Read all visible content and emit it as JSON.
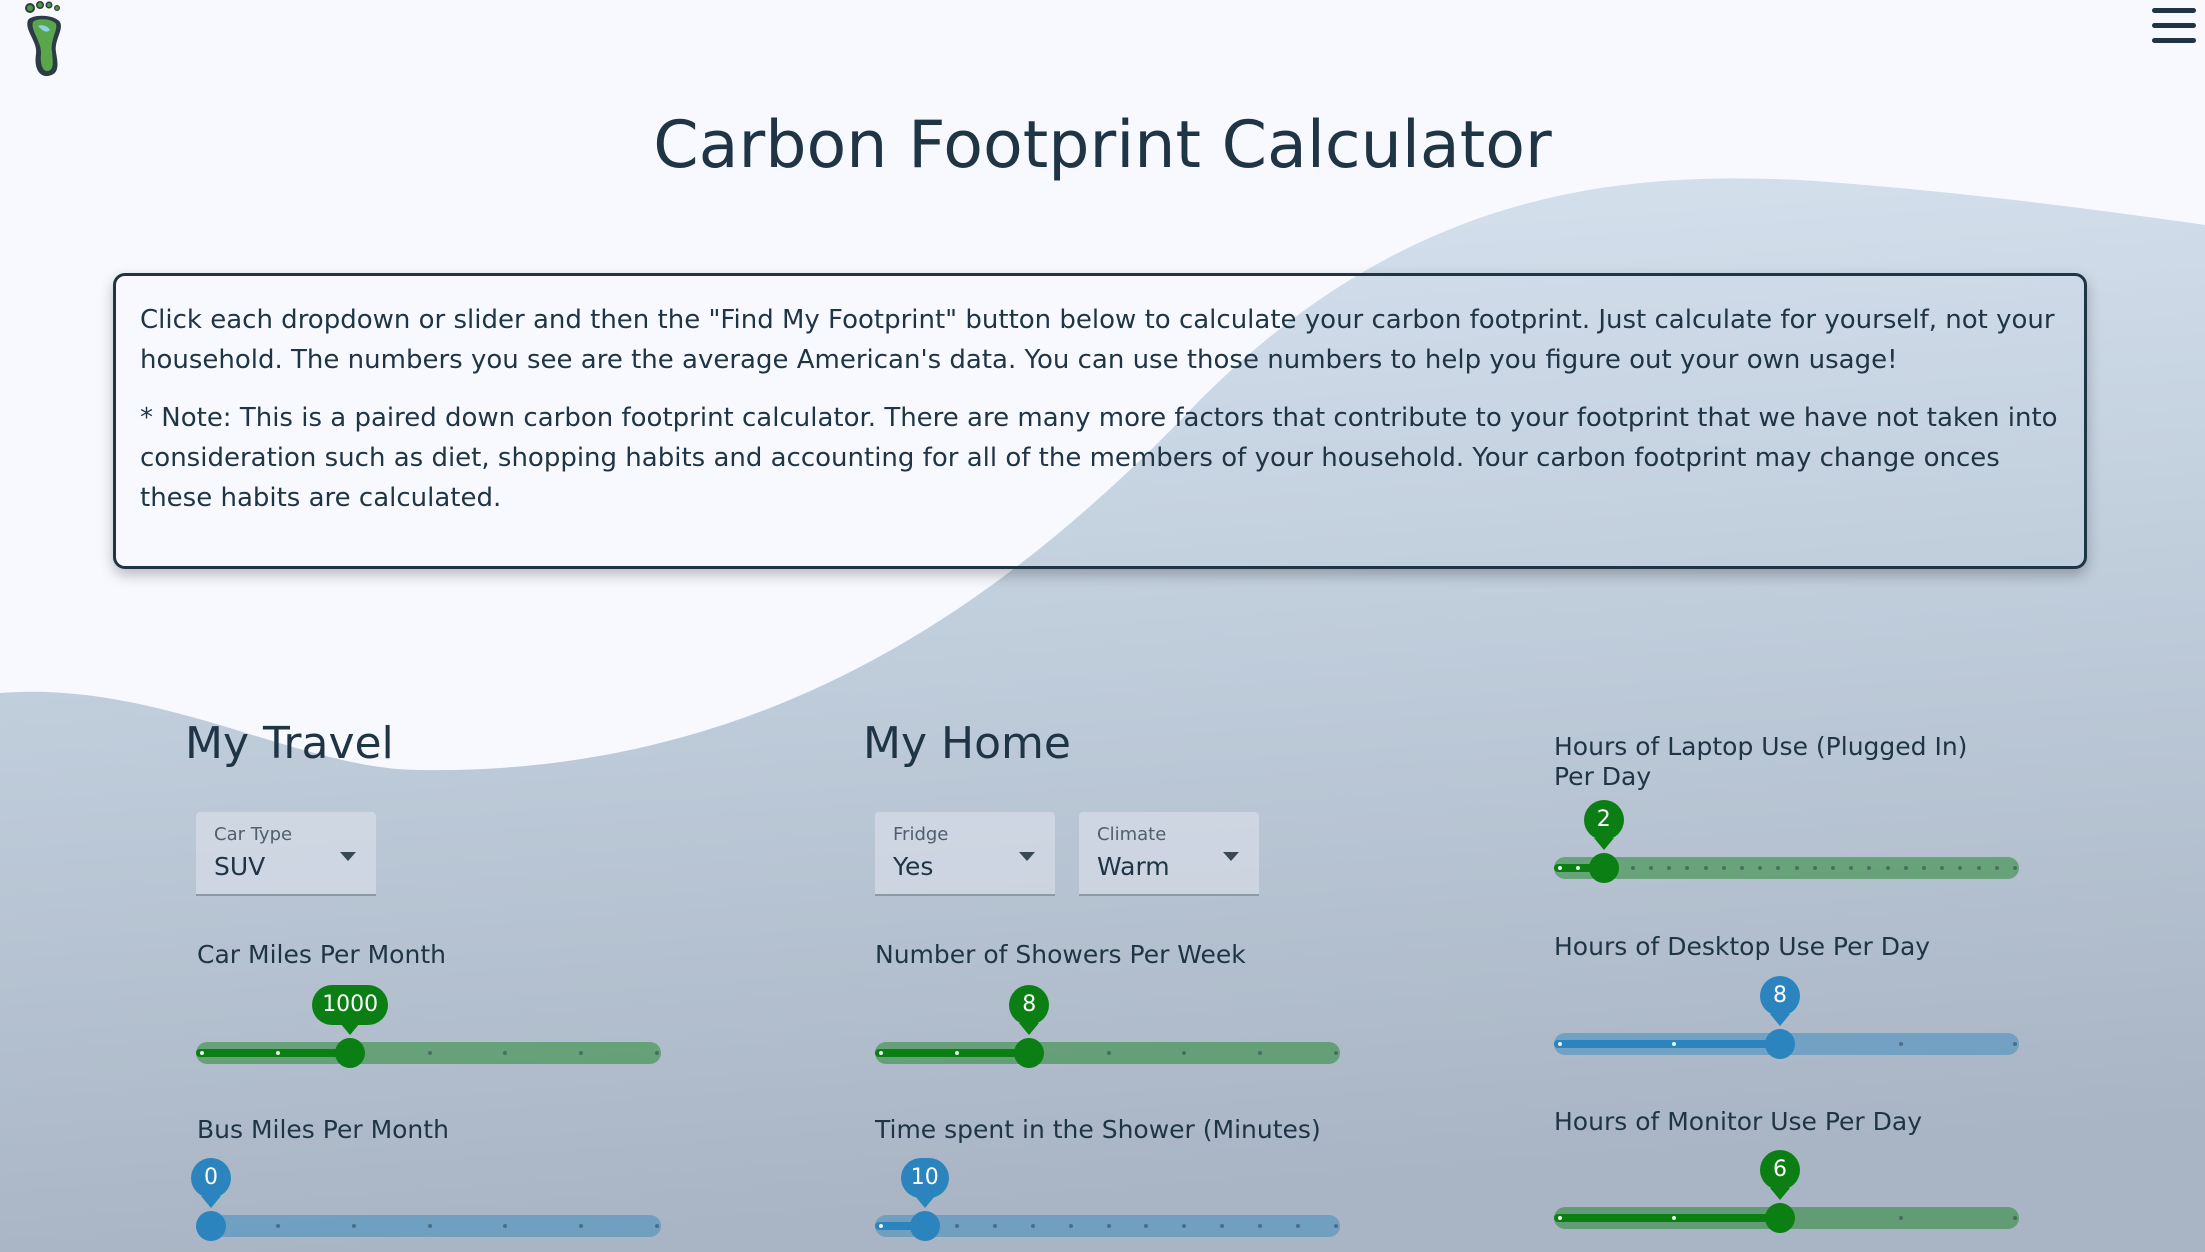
{
  "page": {
    "title": "Carbon Footprint Calculator"
  },
  "info": {
    "paragraph_1": "Click each dropdown or slider and then the \"Find My Footprint\" button below to calculate your carbon footprint. Just calculate for yourself, not your household. The numbers you see are the average American's data. You can use those numbers to help you figure out your own usage!",
    "paragraph_2": "* Note: This is a paired down carbon footprint calculator. There are many more factors that contribute to your footprint that we have not taken into consideration such as diet, shopping habits and accounting for all of the members of your household. Your carbon footprint may change onces these habits are calculated."
  },
  "icons": {
    "logo": "footprint-logo-icon",
    "menu": "hamburger-menu-icon"
  },
  "colors": {
    "green": "#0b7f14",
    "blue": "#2b84bd",
    "text": "#1f3444"
  },
  "travel": {
    "title": "My Travel",
    "car_type": {
      "label": "Car Type",
      "value": "SUV"
    },
    "car_miles": {
      "label": "Car Miles Per Month",
      "value": "1000",
      "fraction": 0.32,
      "ticks": 7
    },
    "bus_miles": {
      "label": "Bus Miles Per Month",
      "value": "0",
      "fraction": 0.0,
      "ticks": 7
    }
  },
  "home": {
    "title": "My Home",
    "fridge": {
      "label": "Fridge",
      "value": "Yes"
    },
    "climate": {
      "label": "Climate",
      "value": "Warm"
    },
    "showers": {
      "label": "Number of Showers Per Week",
      "value": "8",
      "fraction": 0.32,
      "ticks": 7
    },
    "shower_time": {
      "label": "Time spent in the Shower (Minutes)",
      "value": "10",
      "fraction": 0.08,
      "ticks": 13
    }
  },
  "devices": {
    "laptop": {
      "label": "Hours of Laptop Use (Plugged In) Per Day",
      "value": "2",
      "fraction": 0.08,
      "ticks": 26
    },
    "desktop": {
      "label": "Hours of Desktop Use Per Day",
      "value": "8",
      "fraction": 0.485,
      "ticks": 5
    },
    "monitor": {
      "label": "Hours of Monitor Use Per Day",
      "value": "6",
      "fraction": 0.485,
      "ticks": 5
    }
  }
}
